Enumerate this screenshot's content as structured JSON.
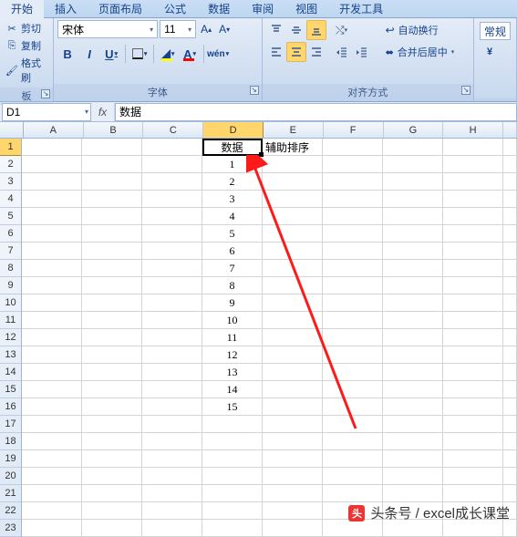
{
  "tabs": [
    "开始",
    "插入",
    "页面布局",
    "公式",
    "数据",
    "审阅",
    "视图",
    "开发工具"
  ],
  "clipboard": {
    "cut": "剪切",
    "copy": "复制",
    "format_painter": "格式刷",
    "group_label": "板"
  },
  "font": {
    "name": "宋体",
    "size": "11",
    "group_label": "字体"
  },
  "align": {
    "wrap": "自动换行",
    "merge": "合并后居中",
    "group_label": "对齐方式"
  },
  "number": {
    "general": "常规",
    "group_label": ""
  },
  "formula_bar": {
    "cell_ref": "D1",
    "fx": "fx",
    "value": "数据"
  },
  "columns": [
    "A",
    "B",
    "C",
    "D",
    "E",
    "F",
    "G",
    "H",
    ""
  ],
  "sheet": {
    "d1": "数据",
    "e1": "辅助排序",
    "d_values": [
      "1",
      "2",
      "3",
      "4",
      "5",
      "6",
      "7",
      "8",
      "9",
      "10",
      "11",
      "12",
      "13",
      "14",
      "15"
    ]
  },
  "watermark": "头条号 / excel成长课堂",
  "chart_data": {
    "type": "table",
    "title": "",
    "columns": [
      "数据",
      "辅助排序"
    ],
    "values_数据": [
      1,
      2,
      3,
      4,
      5,
      6,
      7,
      8,
      9,
      10,
      11,
      12,
      13,
      14,
      15
    ]
  }
}
